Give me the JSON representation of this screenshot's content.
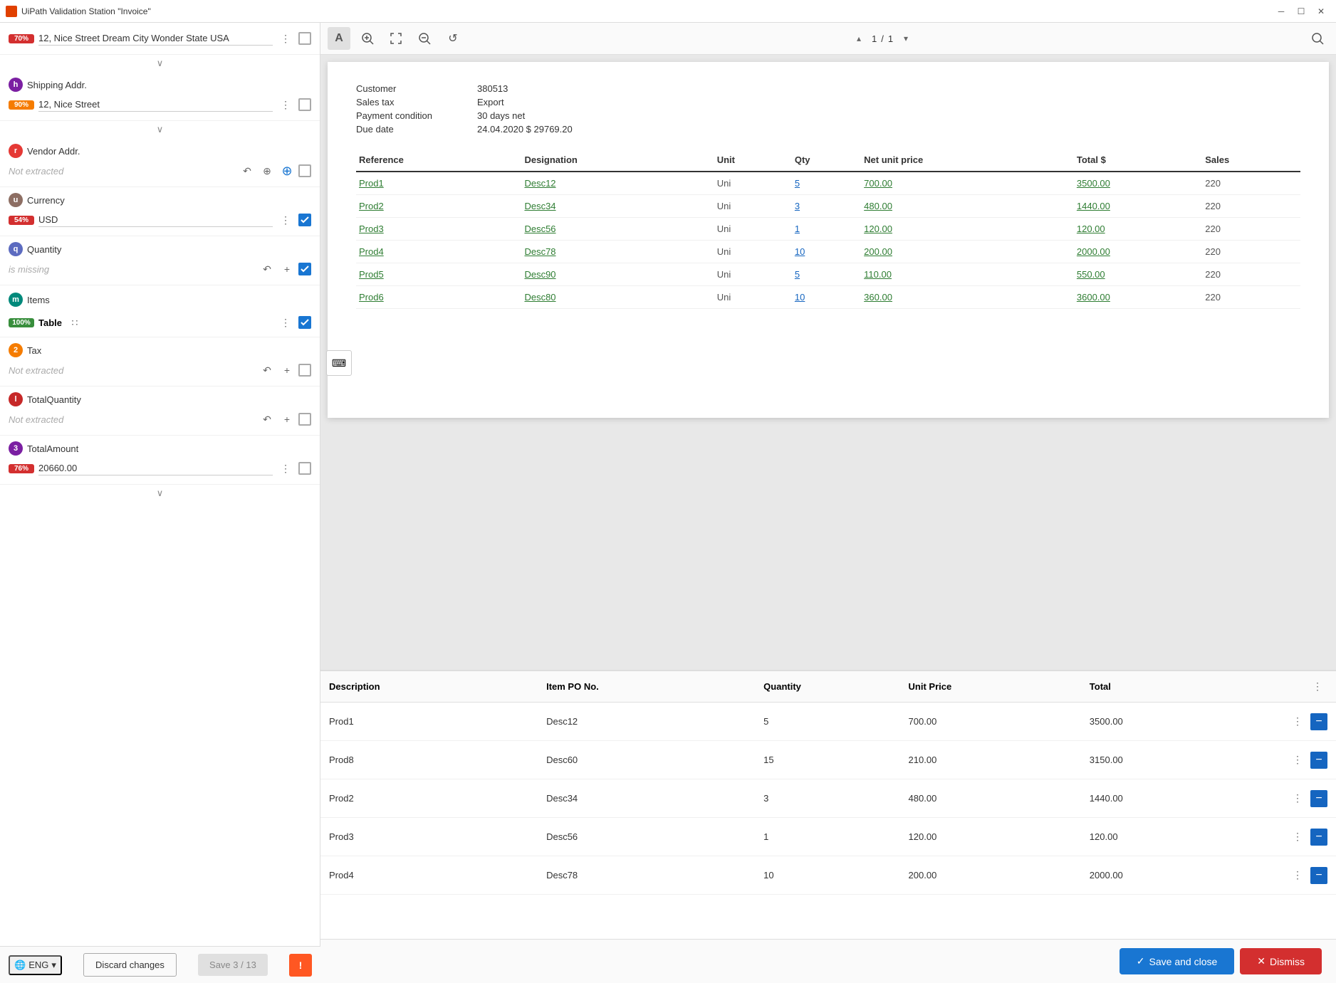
{
  "titleBar": {
    "appIcon": "uipath-icon",
    "appName": "UiPath Validation Station",
    "docName": "\"Invoice\"",
    "controls": [
      "minimize",
      "maximize",
      "close"
    ]
  },
  "leftPanel": {
    "fields": [
      {
        "id": "shipping-addr",
        "letter": "h",
        "letterBg": "#7b1fa2",
        "label": "Shipping Addr.",
        "badge": null,
        "value": "12, Nice Street",
        "badgeText": "90%",
        "badgeClass": "badge-orange",
        "hasChevron": true,
        "showChevronAbove": true
      },
      {
        "id": "vendor-addr",
        "letter": "r",
        "letterBg": "#e53935",
        "label": "Vendor Addr.",
        "badge": null,
        "value": null,
        "placeholder": "Not extracted",
        "badgeText": null
      },
      {
        "id": "currency",
        "letter": "u",
        "letterBg": "#8d6e63",
        "label": "Currency",
        "value": "USD",
        "badgeText": "54%",
        "badgeClass": "badge-red"
      },
      {
        "id": "quantity",
        "letter": "q",
        "letterBg": "#5c6bc0",
        "label": "Quantity",
        "value": null,
        "placeholder": "is missing",
        "badgeText": null
      },
      {
        "id": "items",
        "letter": "m",
        "letterBg": "#00897b",
        "label": "Items",
        "badgeText": "100%",
        "badgeClass": "badge-green",
        "isTable": true,
        "tableLabel": "Table"
      },
      {
        "id": "tax",
        "letter": "2",
        "letterBg": "#f57c00",
        "label": "Tax",
        "value": null,
        "placeholder": "Not extracted",
        "badgeText": null
      },
      {
        "id": "total-quantity",
        "letter": "l",
        "letterBg": "#c62828",
        "label": "TotalQuantity",
        "value": null,
        "placeholder": "Not extracted",
        "badgeText": null
      },
      {
        "id": "total-amount",
        "letter": "3",
        "letterBg": "#7b1fa2",
        "label": "TotalAmount",
        "value": "20660.00",
        "badgeText": "76%",
        "badgeClass": "badge-red"
      }
    ],
    "topAddress": {
      "badgeText": "70%",
      "badgeClass": "badge-red",
      "value": "12, Nice Street Dream City Wonder State USA"
    },
    "bottomBar": {
      "language": "ENG",
      "discardLabel": "Discard changes",
      "saveLabel": "Save 3 / 13",
      "alertLabel": "!"
    }
  },
  "rightPanel": {
    "toolbar": {
      "textTool": "A",
      "zoomIn": "+",
      "zoomOut": "-",
      "fitScreen": "⤢",
      "refresh": "↻",
      "search": "🔍",
      "page": "1",
      "pageTotal": "1"
    },
    "document": {
      "customer": "380513",
      "salesTax": "Export",
      "paymentCondition": "30 days net",
      "dueDate": "24.04.2020 $ 29769.20",
      "tableHeaders": [
        "Reference",
        "Designation",
        "Unit",
        "Qty",
        "Net unit price",
        "Total $",
        "Sales"
      ],
      "tableRows": [
        {
          "ref": "Prod1",
          "desc": "Desc12",
          "unit": "Uni",
          "qty": "5",
          "price": "700.00",
          "total": "3500.00",
          "sales": "220"
        },
        {
          "ref": "Prod2",
          "desc": "Desc34",
          "unit": "Uni",
          "qty": "3",
          "price": "480.00",
          "total": "1440.00",
          "sales": "220"
        },
        {
          "ref": "Prod3",
          "desc": "Desc56",
          "unit": "Uni",
          "qty": "1",
          "price": "120.00",
          "total": "120.00",
          "sales": "220"
        },
        {
          "ref": "Prod4",
          "desc": "Desc78",
          "unit": "Uni",
          "qty": "10",
          "price": "200.00",
          "total": "2000.00",
          "sales": "220"
        },
        {
          "ref": "Prod5",
          "desc": "Desc90",
          "unit": "Uni",
          "qty": "5",
          "price": "110.00",
          "total": "550.00",
          "sales": "220"
        },
        {
          "ref": "Prod6",
          "desc": "Desc80",
          "unit": "Uni",
          "qty": "10",
          "price": "360.00",
          "total": "3600.00",
          "sales": "220"
        }
      ]
    },
    "dataTable": {
      "headers": [
        "Description",
        "Item PO No.",
        "Quantity",
        "Unit Price",
        "Total"
      ],
      "rows": [
        {
          "desc": "Prod1",
          "itemPO": "Desc12",
          "qty": "5",
          "unitPrice": "700.00",
          "total": "3500.00"
        },
        {
          "desc": "Prod8",
          "itemPO": "Desc60",
          "qty": "15",
          "unitPrice": "210.00",
          "total": "3150.00"
        },
        {
          "desc": "Prod2",
          "itemPO": "Desc34",
          "qty": "3",
          "unitPrice": "480.00",
          "total": "1440.00"
        },
        {
          "desc": "Prod3",
          "itemPO": "Desc56",
          "qty": "1",
          "unitPrice": "120.00",
          "total": "120.00"
        },
        {
          "desc": "Prod4",
          "itemPO": "Desc78",
          "qty": "10",
          "unitPrice": "200.00",
          "total": "2000.00"
        }
      ]
    },
    "actions": {
      "saveAndClose": "Save and close",
      "dismiss": "Dismiss"
    }
  }
}
